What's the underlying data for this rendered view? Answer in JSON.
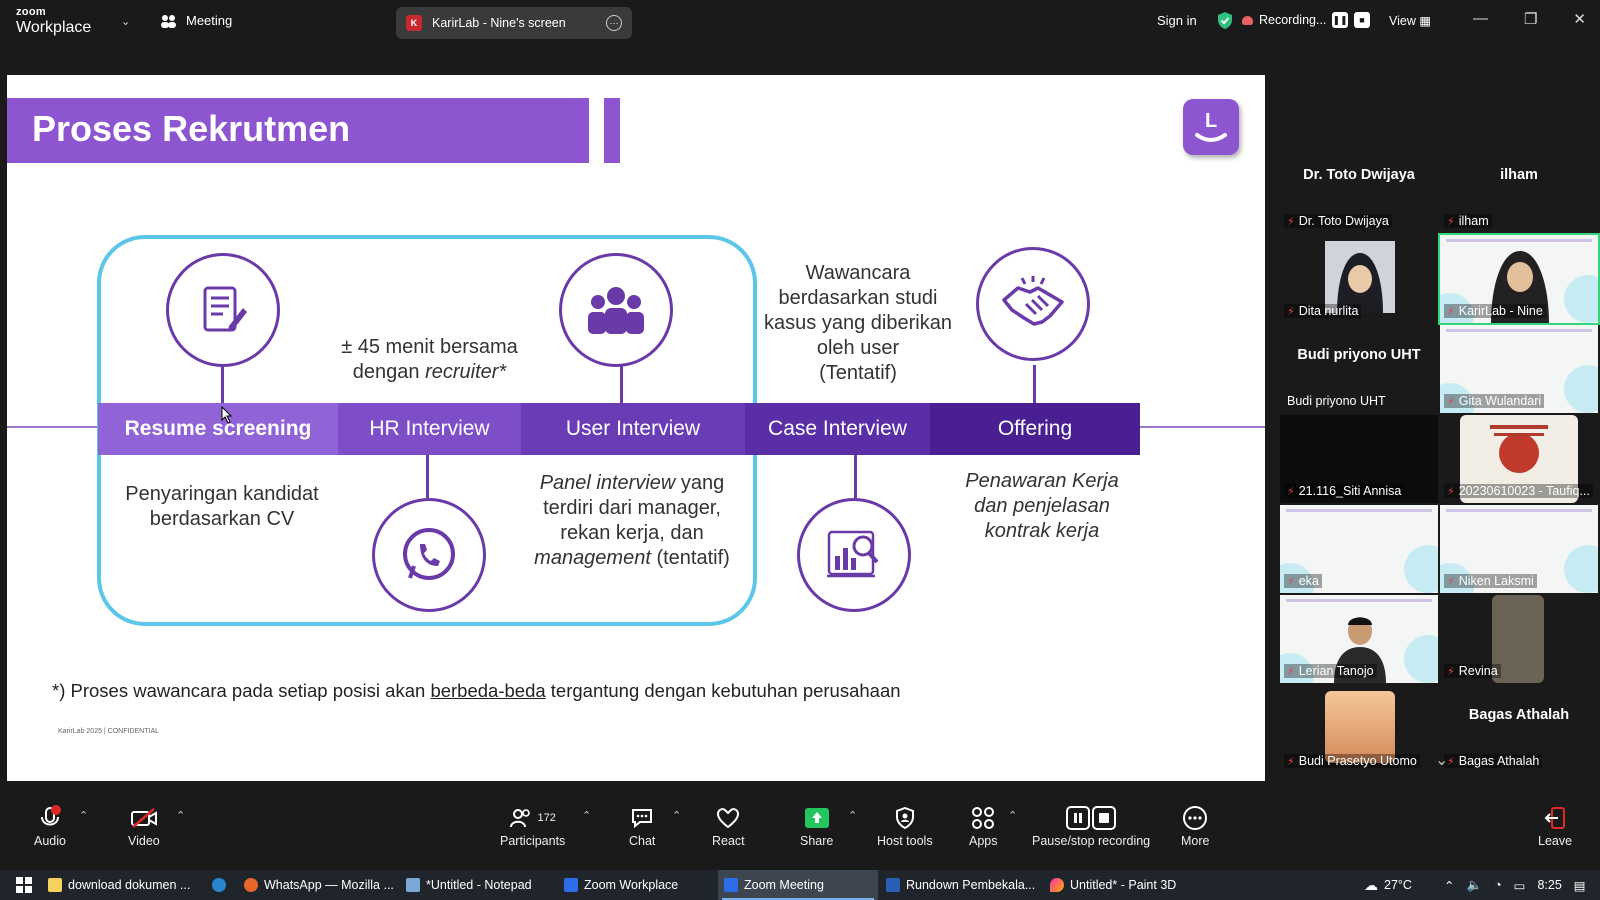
{
  "titlebar": {
    "logo_line1": "zoom",
    "logo_line2": "Workplace",
    "meeting_label": "Meeting",
    "share_title": "KarirLab - Nine's screen",
    "share_icon_letter": "K",
    "signin_label": "Sign in",
    "recording_label": "Recording...",
    "view_label": "View"
  },
  "slide": {
    "title": "Proses Rekrutmen",
    "steps": [
      "Resume screening",
      "HR Interview",
      "User Interview",
      "Case Interview",
      "Offering"
    ],
    "desc_resume": [
      "Penyaringan kandidat",
      "berdasarkan CV"
    ],
    "desc_hr": [
      "± 45 menit bersama",
      "dengan ",
      "recruiter*"
    ],
    "desc_user": [
      "Panel interview",
      " yang",
      "terdiri dari manager,",
      "rekan kerja, dan",
      "management",
      " (tentatif)"
    ],
    "desc_case": [
      "Wawancara",
      "berdasarkan studi",
      "kasus yang diberikan",
      "oleh user",
      "(Tentatif)"
    ],
    "desc_offering": [
      "Penawaran Kerja",
      "dan penjelasan",
      "kontrak kerja"
    ],
    "footnote_pre": "*) Proses wawancara pada setiap posisi akan ",
    "footnote_u": "berbeda-beda",
    "footnote_post": " tergantung dengan kebutuhan perusahaan",
    "confidential": "KarirLab 2025 | CONFIDENTIAL",
    "colors": {
      "accent": "#8d55d0",
      "frame": "#5cc6e8",
      "step1": "#9063d6",
      "step2": "#7d4ec8",
      "step3": "#6a3cb6",
      "step4": "#5a2ea6",
      "step5": "#4a1f92"
    }
  },
  "gallery": {
    "tiles": [
      {
        "name": "Dr. Toto Dwijaya",
        "label": "Dr. Toto Dwijaya"
      },
      {
        "name": "ilham",
        "label": "ilham"
      },
      {
        "label": "Dita nurlita"
      },
      {
        "label": "KarirLab - Nine"
      },
      {
        "name": "Budi priyono UHT",
        "label": "Budi priyono UHT"
      },
      {
        "label": "Gita Wulandari"
      },
      {
        "label": "21.116_Siti Annisa"
      },
      {
        "label": "20230610023 - Taufiq..."
      },
      {
        "label": "eka"
      },
      {
        "label": "Niken Laksmi"
      },
      {
        "label": "Lerian Tanojo"
      },
      {
        "label": "Revina"
      },
      {
        "label": "Budi Prasetyo Utomo"
      },
      {
        "name": "Bagas Athalah",
        "label": "Bagas Athalah"
      }
    ]
  },
  "toolbar": {
    "audio": "Audio",
    "video": "Video",
    "participants": "Participants",
    "participants_count": "172",
    "chat": "Chat",
    "react": "React",
    "share": "Share",
    "host_tools": "Host tools",
    "apps": "Apps",
    "pause_recording": "Pause/stop recording",
    "more": "More",
    "leave": "Leave"
  },
  "taskbar": {
    "items": [
      "download dokumen ...",
      "WhatsApp — Mozilla ...",
      "*Untitled - Notepad",
      "Zoom Workplace",
      "Zoom Meeting",
      "Rundown Pembekala...",
      "Untitled* - Paint 3D"
    ],
    "temperature": "27°C",
    "time": "8:25"
  }
}
